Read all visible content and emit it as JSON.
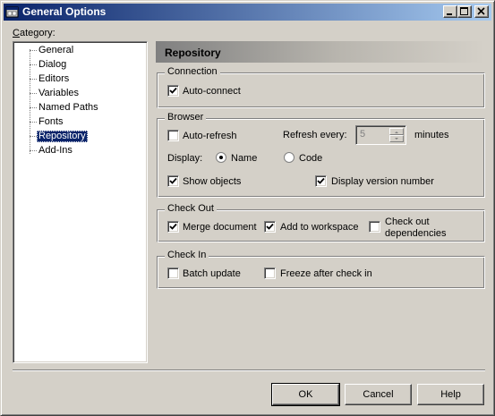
{
  "window": {
    "title": "General Options"
  },
  "category": {
    "label": "Category:",
    "items": [
      "General",
      "Dialog",
      "Editors",
      "Variables",
      "Named Paths",
      "Fonts",
      "Repository",
      "Add-Ins"
    ],
    "selected": "Repository"
  },
  "page": {
    "header": "Repository"
  },
  "connection": {
    "group_label": "Connection",
    "auto_connect": {
      "label": "Auto-connect",
      "checked": true
    }
  },
  "browser": {
    "group_label": "Browser",
    "auto_refresh": {
      "label": "Auto-refresh",
      "checked": false
    },
    "refresh_every_label": "Refresh every:",
    "refresh_value": "5",
    "minutes_label": "minutes",
    "display_label": "Display:",
    "display_name": {
      "label": "Name",
      "selected": true
    },
    "display_code": {
      "label": "Code",
      "selected": false
    },
    "show_objects": {
      "label": "Show objects",
      "checked": true
    },
    "display_version": {
      "label": "Display version number",
      "checked": true
    }
  },
  "checkout": {
    "group_label": "Check Out",
    "merge_document": {
      "label": "Merge document",
      "checked": true
    },
    "add_to_workspace": {
      "label": "Add to workspace",
      "checked": true
    },
    "check_out_deps": {
      "label_line1": "Check out",
      "label_line2": "dependencies",
      "checked": false
    }
  },
  "checkin": {
    "group_label": "Check In",
    "batch_update": {
      "label": "Batch update",
      "checked": false
    },
    "freeze": {
      "label": "Freeze after check in",
      "checked": false
    }
  },
  "buttons": {
    "ok": "OK",
    "cancel": "Cancel",
    "help": "Help"
  },
  "colors": {
    "title_active": "#0a246a",
    "selection": "#0a246a",
    "face": "#d4d0c8"
  }
}
